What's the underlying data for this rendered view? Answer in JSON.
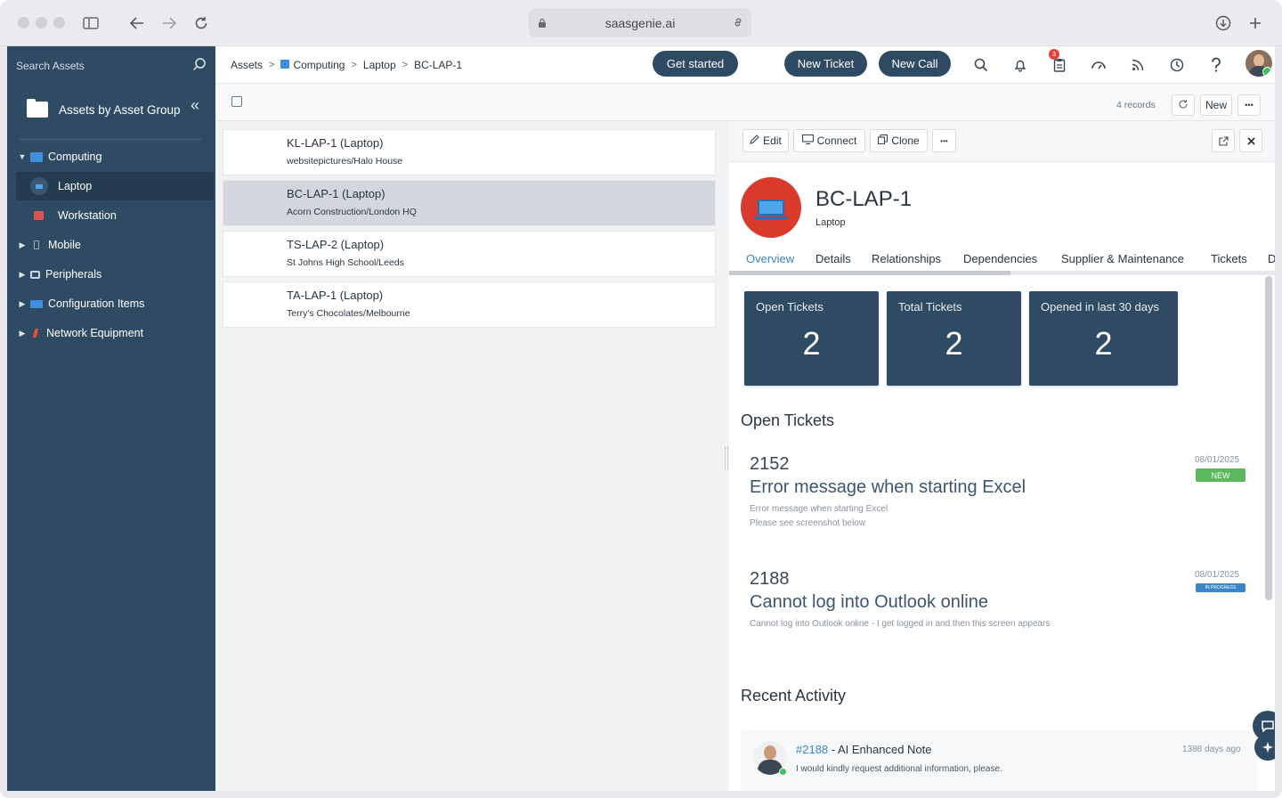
{
  "browser": {
    "url": "saasgenie.ai"
  },
  "sidebar": {
    "search_placeholder": "Search Assets",
    "group_title": "Assets by Asset Group",
    "collapse_glyph": "«",
    "items": [
      {
        "label": "Computing",
        "caret": "▼",
        "icon": "computing-icon",
        "color": "#3d8fe0"
      },
      {
        "label": "Laptop",
        "icon": "laptop-icon",
        "color": "#4fa6ea"
      },
      {
        "label": "Workstation",
        "icon": "workstation-icon",
        "color": "#d9534f"
      },
      {
        "label": "Mobile",
        "caret": "▶",
        "icon": "mobile-icon"
      },
      {
        "label": "Peripherals",
        "caret": "▶",
        "icon": "peripherals-icon"
      },
      {
        "label": "Configuration Items",
        "caret": "▶",
        "icon": "configuration-icon",
        "color": "#3d8fe0"
      },
      {
        "label": "Network Equipment",
        "caret": "▶",
        "icon": "network-icon",
        "color": "#e74c3c"
      }
    ]
  },
  "header": {
    "breadcrumb": [
      "Assets",
      "Computing",
      "Laptop",
      "BC-LAP-1"
    ],
    "breadcrumb_sep": ">",
    "get_started": "Get started",
    "new_ticket": "New Ticket",
    "new_call": "New Call",
    "notification_count": "3"
  },
  "subbar": {
    "records": "4 records",
    "new_label": "New",
    "more_label": "•••"
  },
  "assets": [
    {
      "title": "KL-LAP-1 (Laptop)",
      "subtitle": "websitepictures/Halo House"
    },
    {
      "title": "BC-LAP-1 (Laptop)",
      "subtitle": "Acorn Construction/London HQ",
      "selected": true
    },
    {
      "title": "TS-LAP-2 (Laptop)",
      "subtitle": "St Johns High School/Leeds"
    },
    {
      "title": "TA-LAP-1 (Laptop)",
      "subtitle": "Terry's Chocolates/Melbourne"
    }
  ],
  "detail": {
    "toolbar": {
      "edit": "Edit",
      "connect": "Connect",
      "clone": "Clone",
      "more": "•••"
    },
    "title": "BC-LAP-1",
    "subtitle": "Laptop",
    "tabs": [
      "Overview",
      "Details",
      "Relationships",
      "Dependencies",
      "Supplier & Maintenance",
      "Tickets",
      "D"
    ],
    "stats": [
      {
        "label": "Open Tickets",
        "value": "2"
      },
      {
        "label": "Total Tickets",
        "value": "2"
      },
      {
        "label": "Opened in last 30 days",
        "value": "2"
      }
    ],
    "open_tickets_heading": "Open Tickets",
    "tickets": [
      {
        "id": "2152",
        "title": "Error message when starting Excel",
        "desc1": "Error message when starting Excel",
        "desc2": "Please see screenshot below",
        "date": "08/01/2025",
        "status": "NEW",
        "status_color": "#5cb85c"
      },
      {
        "id": "2188",
        "title": "Cannot log into Outlook online",
        "desc1": "Cannot log into Outlook online - I get logged in and then this screen appears",
        "desc2": "",
        "date": "08/01/2025",
        "status": "IN PROGRESS",
        "status_color": "#3a86c8"
      }
    ],
    "recent_heading": "Recent Activity",
    "activity": {
      "link": "#2188",
      "text": " - AI Enhanced Note",
      "sub": "I would kindly request additional information, please.",
      "time": "1388 days ago"
    }
  }
}
